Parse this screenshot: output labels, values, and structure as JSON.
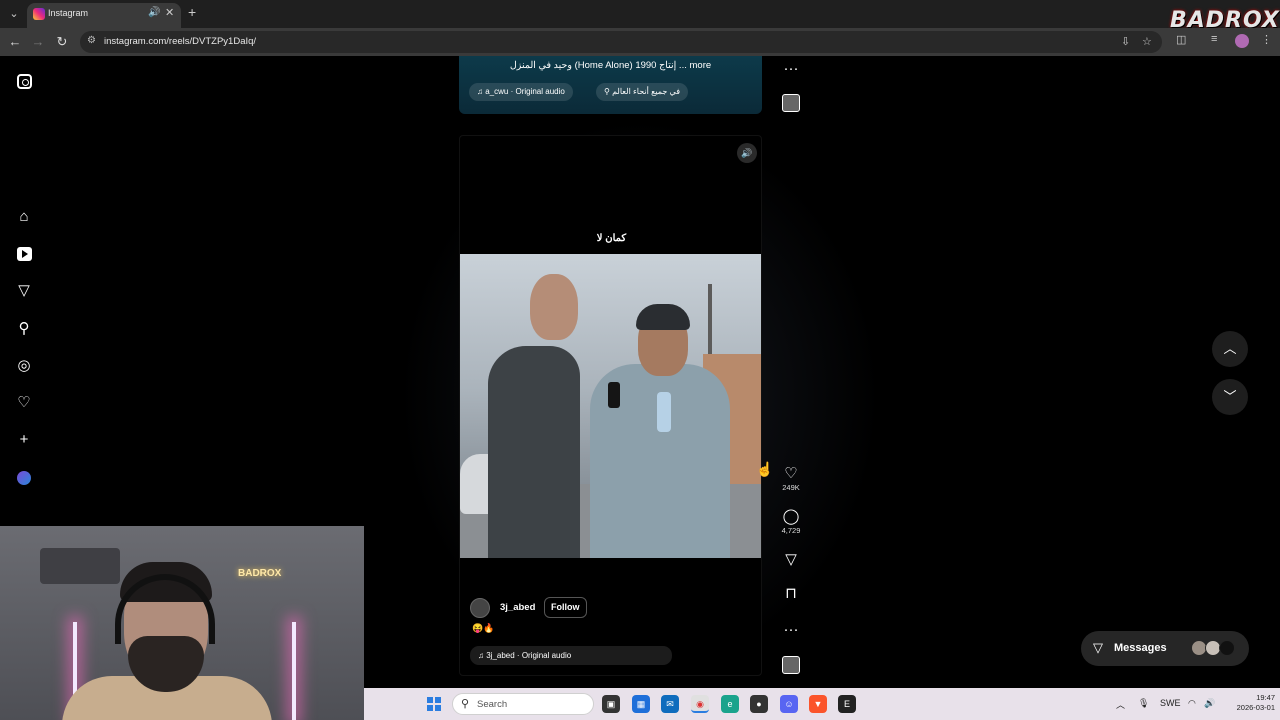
{
  "browser": {
    "tab_title": "Instagram",
    "url": "instagram.com/reels/DVTZPy1DaIq/",
    "brand_overlay": "BADROX"
  },
  "sidebar": {
    "icons": [
      "instagram-icon",
      "home-icon",
      "reels-icon",
      "messages-icon",
      "search-icon",
      "explore-icon",
      "notifications-icon",
      "create-icon",
      "profile-avatar"
    ]
  },
  "top_reel": {
    "caption": "وحيد في المنزل (Home Alone) إنتاج 1990 ... more",
    "audio": "a_cwu · Original audio",
    "location": "في جميع أنحاء العالم"
  },
  "reel": {
    "subtitle": "كمان لا",
    "username": "3j_abed",
    "follow_label": "Follow",
    "caption_emojis": "😝🔥",
    "audio": "3j_abed · Original audio"
  },
  "actions": {
    "likes": "249K",
    "comments": "4,729"
  },
  "messages": {
    "label": "Messages"
  },
  "webcam": {
    "neon_sign": "BADROX"
  },
  "taskbar": {
    "search_placeholder": "Search",
    "language": "SWE",
    "time": "19:47",
    "date": "2026-03-01"
  },
  "colors": {
    "accent": "#0095f6",
    "page_bg": "#000000"
  }
}
